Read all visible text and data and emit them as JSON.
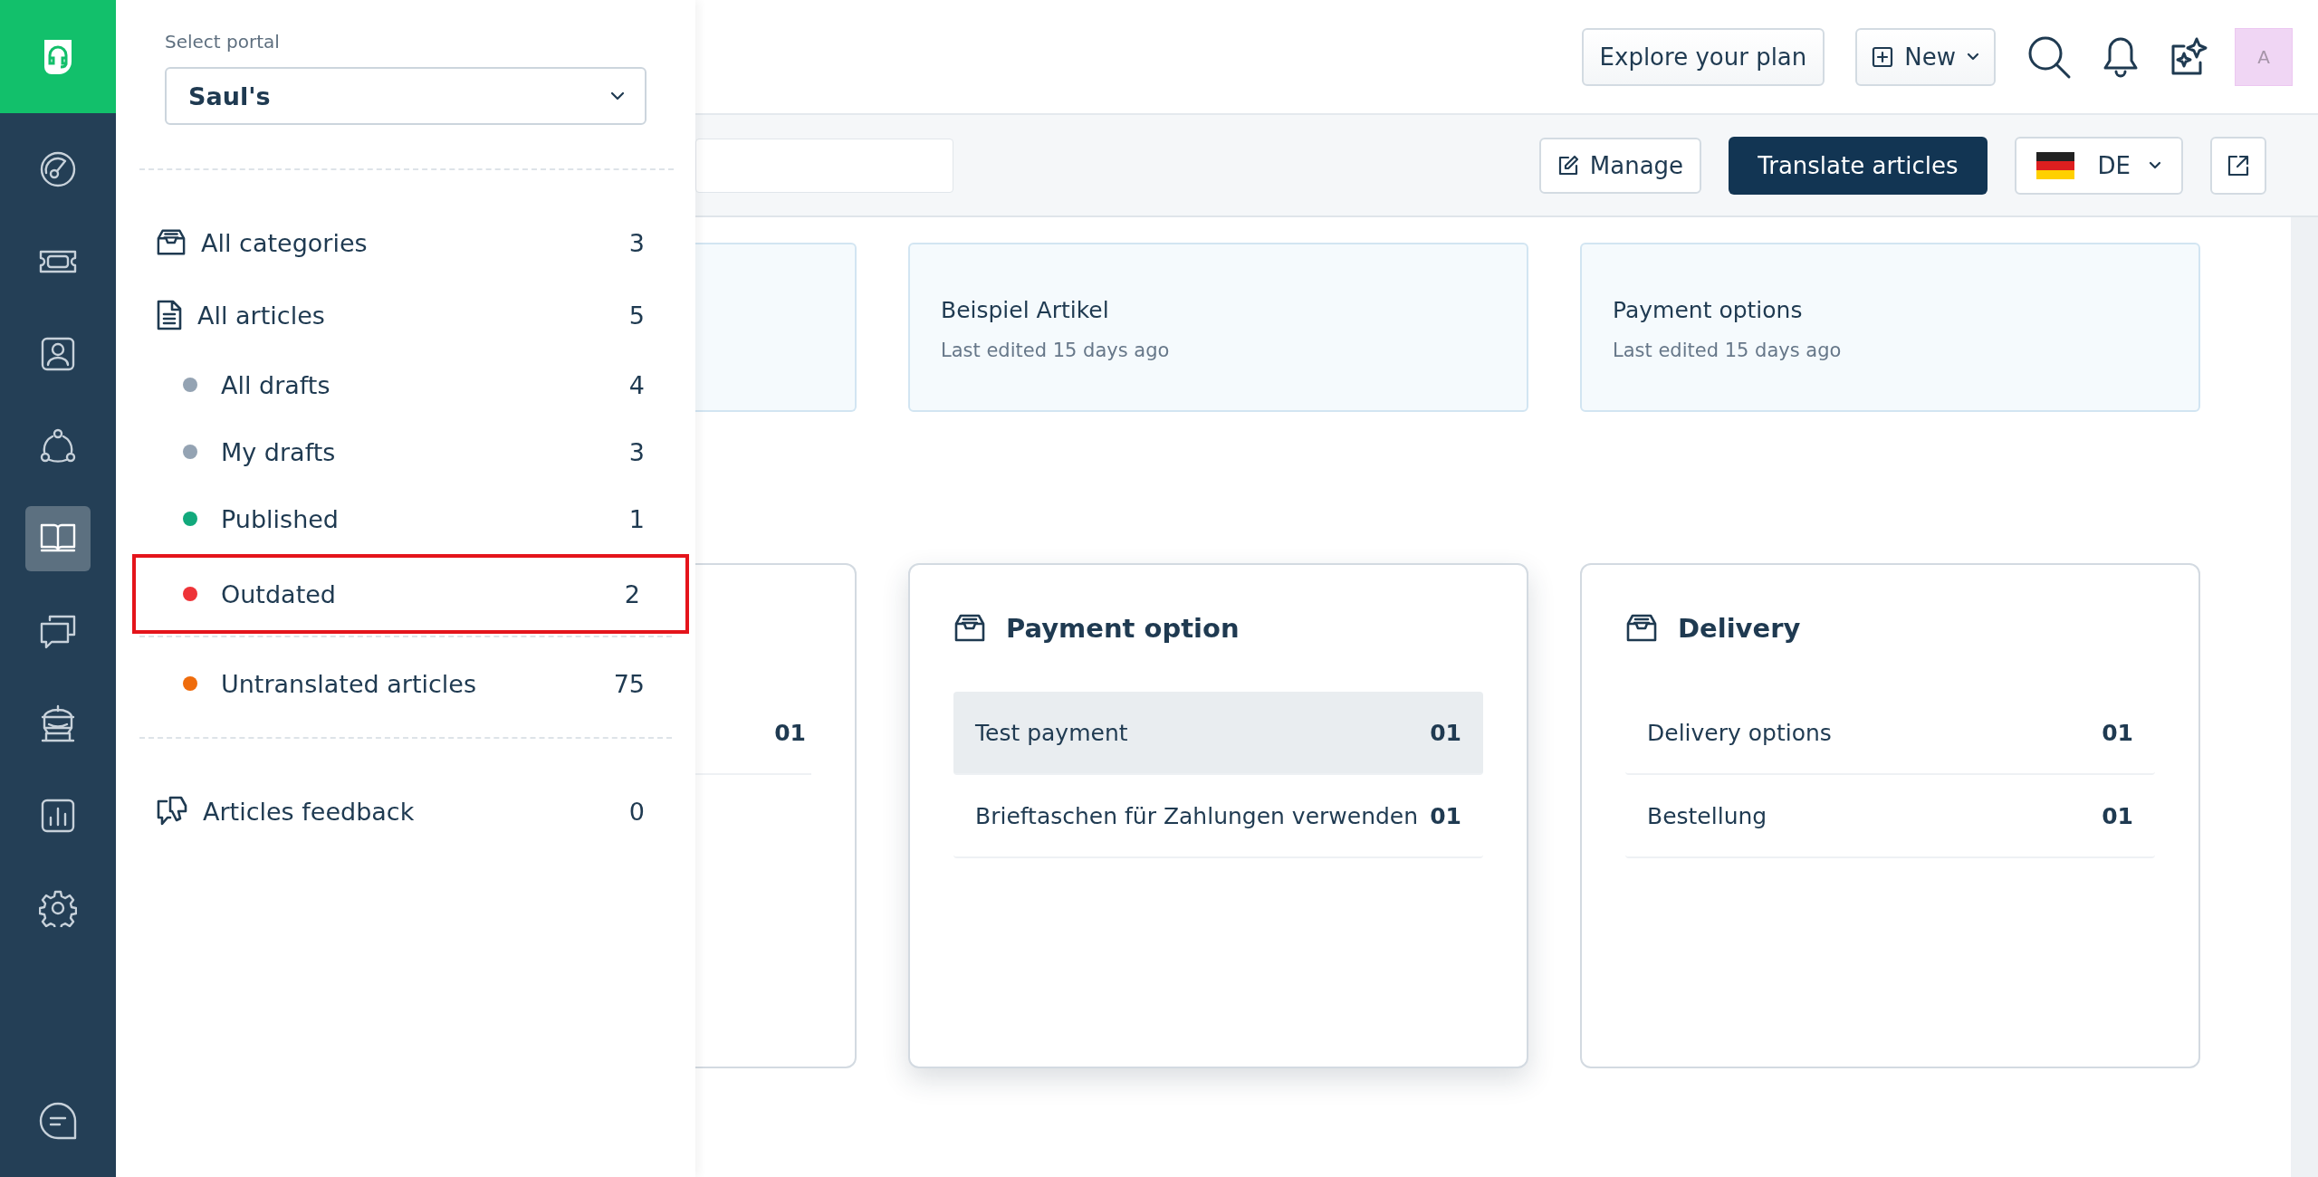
{
  "rail": {
    "items": [
      {
        "selected": false
      },
      {
        "selected": false
      },
      {
        "selected": false
      },
      {
        "selected": false
      },
      {
        "selected": true
      },
      {
        "selected": false
      },
      {
        "selected": false
      },
      {
        "selected": false
      },
      {
        "selected": false
      }
    ]
  },
  "topbar": {
    "explore": "Explore your plan",
    "new": "New",
    "avatar": "A"
  },
  "subbar": {
    "manage": "Manage",
    "translate": "Translate articles",
    "language": "DE"
  },
  "panel": {
    "portal_label": "Select portal",
    "portal": "Saul's",
    "groups": [
      {
        "items": [
          {
            "kind": "link",
            "label": "All categories",
            "count": "3"
          },
          {
            "kind": "link",
            "label": "All articles",
            "count": "5"
          },
          {
            "kind": "status",
            "label": "All drafts",
            "count": "4",
            "color": "#94a3b3",
            "highlighted": false
          },
          {
            "kind": "status",
            "label": "My drafts",
            "count": "3",
            "color": "#94a3b3",
            "highlighted": false
          },
          {
            "kind": "status",
            "label": "Published",
            "count": "1",
            "color": "#12a97c",
            "highlighted": false
          },
          {
            "kind": "status",
            "label": "Outdated",
            "count": "2",
            "color": "#ee3338",
            "highlighted": true
          }
        ]
      },
      {
        "items": [
          {
            "kind": "status",
            "label": "Untranslated articles",
            "count": "75",
            "color": "#ef6c0c",
            "highlighted": false
          }
        ]
      },
      {
        "items": [
          {
            "kind": "link",
            "label": "Articles feedback",
            "count": "0"
          }
        ]
      }
    ]
  },
  "articles": [
    {
      "title": "Beispiel Artikel",
      "edited": "Last edited 15 days ago"
    },
    {
      "title": "Payment options",
      "edited": "Last edited 15 days ago"
    }
  ],
  "categories": [
    {
      "hovered": false,
      "items": [
        {
          "count": "01",
          "hovered": false
        }
      ]
    },
    {
      "title": "Payment option",
      "hovered": true,
      "items": [
        {
          "name": "Test payment",
          "count": "01",
          "hovered": true
        },
        {
          "name": "Brieftaschen für Zahlungen verwenden",
          "count": "01",
          "hovered": false
        }
      ]
    },
    {
      "title": "Delivery",
      "hovered": false,
      "items": [
        {
          "name": "Delivery options",
          "count": "01",
          "hovered": false
        },
        {
          "name": "Bestellung",
          "count": "01",
          "hovered": false
        }
      ]
    }
  ]
}
